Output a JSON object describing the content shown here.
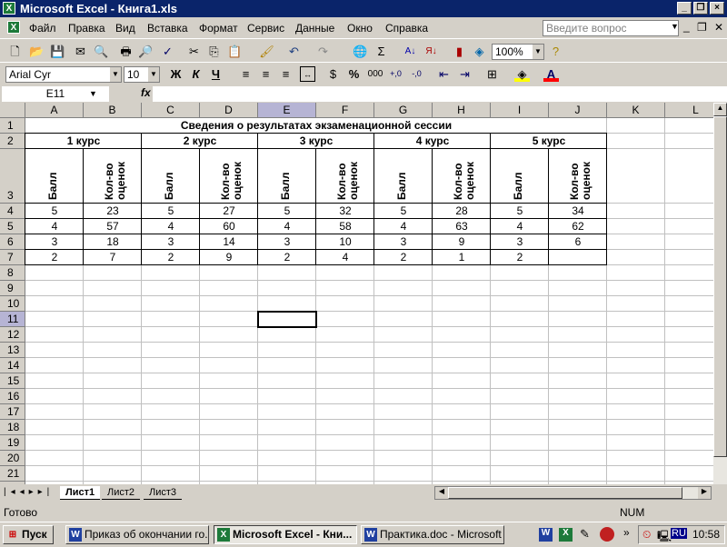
{
  "window": {
    "title": "Microsoft Excel - Книга1.xls"
  },
  "menu": [
    "Файл",
    "Правка",
    "Вид",
    "Вставка",
    "Формат",
    "Сервис",
    "Данные",
    "Окно",
    "Справка"
  ],
  "help_search": {
    "placeholder": "Введите вопрос"
  },
  "toolbar": {
    "zoom": "100%"
  },
  "format_toolbar": {
    "font": "Arial Cyr",
    "size": "10",
    "bold": "Ж",
    "italic": "К",
    "underline": "Ч",
    "percent": "%",
    "thousands": "000"
  },
  "formula_bar": {
    "name_box": "E11",
    "fx": "fx",
    "value": ""
  },
  "columns": [
    "A",
    "B",
    "C",
    "D",
    "E",
    "F",
    "G",
    "H",
    "I",
    "J",
    "K",
    "L"
  ],
  "selected_cell": "E11",
  "sheet": {
    "title": "Сведения о результатах экзаменационной сессии",
    "courses": [
      "1 курс",
      "2 курс",
      "3 курс",
      "4 курс",
      "5 курс"
    ],
    "sub_headers": [
      "Балл",
      "Кол-во оценок"
    ],
    "rows": [
      [
        "5",
        "23",
        "5",
        "27",
        "5",
        "32",
        "5",
        "28",
        "5",
        "34"
      ],
      [
        "4",
        "57",
        "4",
        "60",
        "4",
        "58",
        "4",
        "63",
        "4",
        "62"
      ],
      [
        "3",
        "18",
        "3",
        "14",
        "3",
        "10",
        "3",
        "9",
        "3",
        "6"
      ],
      [
        "2",
        "7",
        "2",
        "9",
        "2",
        "4",
        "2",
        "1",
        "2",
        ""
      ]
    ]
  },
  "sheet_tabs": [
    "Лист1",
    "Лист2",
    "Лист3"
  ],
  "status": {
    "text": "Готово",
    "num": "NUM"
  },
  "taskbar": {
    "start": "Пуск",
    "tasks": [
      "Приказ об окончании го...",
      "Microsoft Excel - Кни...",
      "Практика.doc - Microsoft ..."
    ],
    "lang": "RU",
    "clock": "10:58"
  }
}
